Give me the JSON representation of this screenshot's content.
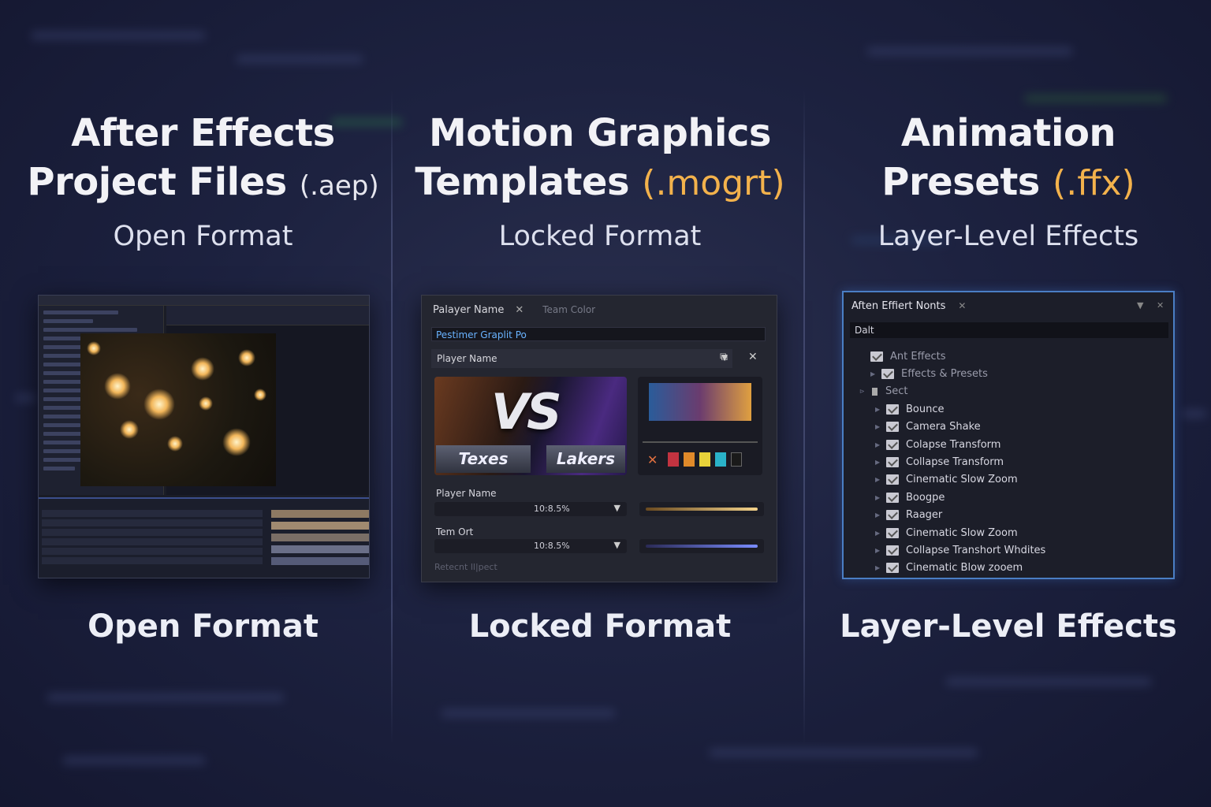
{
  "columns": [
    {
      "title_line1": "After Effects",
      "title_line2": "Project Files",
      "title_ext": "(.aep)",
      "subtitle": "Open Format",
      "caption": "Open Format"
    },
    {
      "title_line1": "Motion Graphics",
      "title_line2": "Templates",
      "title_ext": "(.mogrt)",
      "subtitle": "Locked Format",
      "caption": "Locked Format"
    },
    {
      "title_line1": "Animation",
      "title_line2": "Presets",
      "title_ext": "(.ffx)",
      "subtitle": "Layer-Level Effects",
      "caption": "Layer-Level Effects"
    }
  ],
  "mogrt_panel": {
    "tab_active": "Palayer Name",
    "tab_inactive": "Team Color",
    "selected_field": "Pestimer Graplit Po",
    "dropdown_value": "Player Name",
    "vs_text": "VS",
    "team_left": "Texes",
    "team_right": "Lakers",
    "control1_label": "Player Name",
    "control1_value": "10:8.5%",
    "control2_label": "Tem Ort",
    "control2_value": "10:8.5%",
    "footer": "Retecnt ll|pect",
    "swatch_colors": [
      "#c23340",
      "#e08a2a",
      "#e8d23a",
      "#2ab3c9",
      "#1a1a1a"
    ]
  },
  "effects_panel": {
    "title": "Aften Effiert Nonts",
    "search_value": "Dalt",
    "items": [
      {
        "label": "Ant Effects",
        "indent": 0
      },
      {
        "label": "Effects & Presets",
        "indent": 1
      },
      {
        "label": "Sect",
        "indent": 1
      },
      {
        "label": "Bounce",
        "indent": 2
      },
      {
        "label": "Camera Shake",
        "indent": 2
      },
      {
        "label": "Colapse Transform",
        "indent": 2
      },
      {
        "label": "Collapse Transform",
        "indent": 2
      },
      {
        "label": "Cinematic Slow Zoom",
        "indent": 2
      },
      {
        "label": "Boogpe",
        "indent": 2
      },
      {
        "label": "Raager",
        "indent": 2
      },
      {
        "label": "Cinematic Slow Zoom",
        "indent": 2
      },
      {
        "label": "Collapse Transhort Whdites",
        "indent": 2
      },
      {
        "label": "Cinematic Blow zooem",
        "indent": 2
      }
    ]
  }
}
